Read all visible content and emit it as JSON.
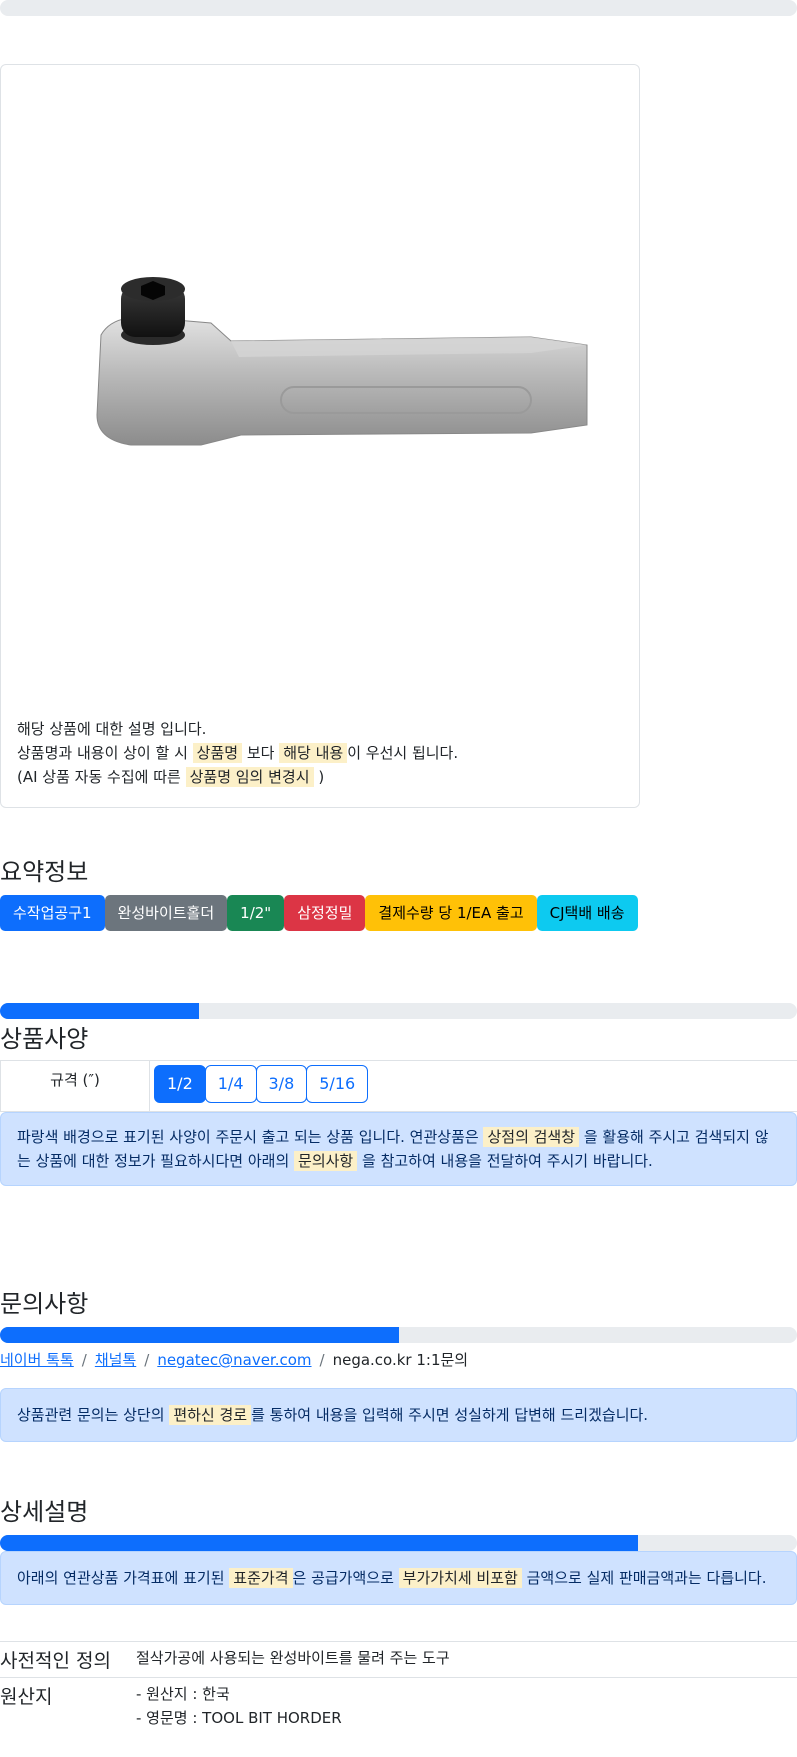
{
  "top_progress": {
    "value": 0
  },
  "card": {
    "image_alt": "tool bit holder",
    "line1": "해당 상품에 대한 설명 입니다.",
    "line2_a": "상품명과 내용이 상이 할 시",
    "line2_mark1": "상품명",
    "line2_b": "보다",
    "line2_mark2": "해당 내용",
    "line2_c": "이 우선시 됩니다.",
    "line3_a": "(AI 상품 자동 수집에 따른",
    "line3_mark": "상품명 임의 변경시",
    "line3_b": ")"
  },
  "summary": {
    "title": "요약정보",
    "badges": [
      "수작업공구1",
      "완성바이트홀더",
      "1/2\"",
      "삼정정밀",
      "결제수량 당 1/EA 출고",
      "CJ택배 배송"
    ]
  },
  "spec": {
    "progress": 0.25,
    "title": "상품사양",
    "label": "규격 (″)",
    "options": [
      "1/2",
      "1/4",
      "3/8",
      "5/16"
    ],
    "selected": "1/2",
    "alert_a": "파랑색 배경으로 표기된 사양이 주문시 출고 되는 상품 입니다. 연관상품은",
    "alert_mark1": "상점의 검색창",
    "alert_b": "을 활용해 주시고 검색되지 않는 상품에 대한 정보가 필요하시다면 아래의",
    "alert_mark2": "문의사항",
    "alert_c": "을 참고하여 내용을 전달하여 주시기 바랍니다."
  },
  "inquiry": {
    "title": "문의사항",
    "progress": 0.5,
    "links": [
      "네이버 톡톡",
      "채널톡",
      "negatec@naver.com"
    ],
    "last": "nega.co.kr 1:1문의",
    "alert_a": "상품관련 문의는 상단의",
    "alert_mark": "편하신 경로",
    "alert_b": "를 통하여 내용을 입력해 주시면 성실하게 답변해 드리겠습니다."
  },
  "detail": {
    "title": "상세설명",
    "progress": 0.8,
    "alert_a": "아래의 연관상품 가격표에 표기된",
    "alert_mark1": "표준가격",
    "alert_b": "은 공급가액으로",
    "alert_mark2": "부가가치세 비포함",
    "alert_c": "금액으로 실제 판매금액과는 다릅니다.",
    "def_label": "사전적인 정의",
    "def_value": "절삭가공에 사용되는 완성바이트를 물려 주는 도구",
    "origin_label": "원산지",
    "origin_line1": "- 원산지 : 한국",
    "origin_line2": "- 영문명 : TOOL BIT HORDER"
  }
}
